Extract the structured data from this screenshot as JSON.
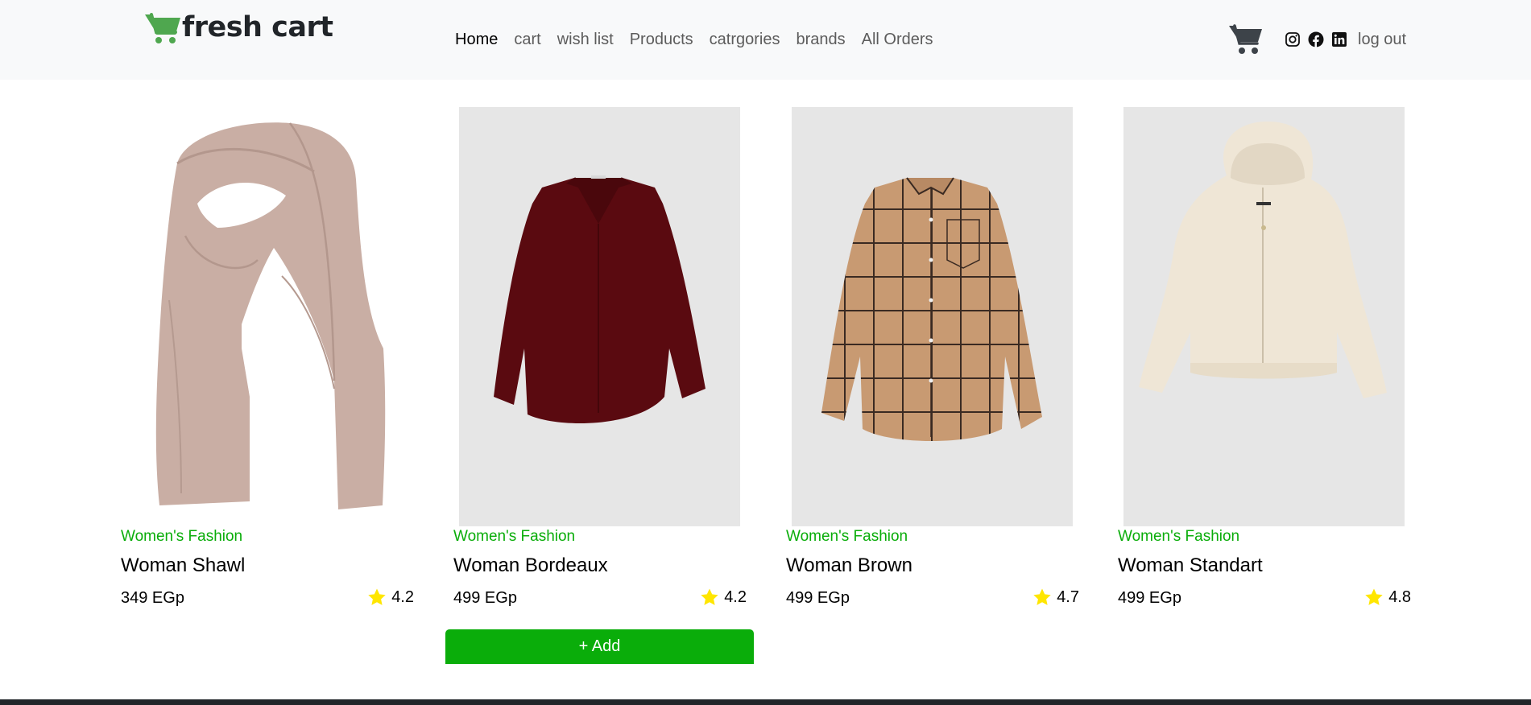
{
  "brand": {
    "name": "fresh cart",
    "icon": "cart-icon",
    "color": "#4fa74f"
  },
  "nav": {
    "links": [
      {
        "label": "Home",
        "active": true
      },
      {
        "label": "cart",
        "active": false
      },
      {
        "label": "wish list",
        "active": false
      },
      {
        "label": "Products",
        "active": false
      },
      {
        "label": "catrgories",
        "active": false
      },
      {
        "label": "brands",
        "active": false
      },
      {
        "label": "All Orders",
        "active": false
      }
    ],
    "right": {
      "cart_icon": "shopping-cart-icon",
      "social_icons": [
        "instagram-icon",
        "facebook-icon",
        "linkedin-icon"
      ],
      "logout_label": "log out"
    }
  },
  "products": [
    {
      "category": "Women's Fashion",
      "title": "Woman Shawl",
      "price": "349 EGp",
      "rating": "4.2"
    },
    {
      "category": "Women's Fashion",
      "title": "Woman Bordeaux",
      "price": "499 EGp",
      "rating": "4.2"
    },
    {
      "category": "Women's Fashion",
      "title": "Woman Brown",
      "price": "499 EGp",
      "rating": "4.7"
    },
    {
      "category": "Women's Fashion",
      "title": "Woman Standart",
      "price": "499 EGp",
      "rating": "4.8"
    }
  ],
  "add_button": {
    "label": "+ Add"
  },
  "colors": {
    "accent": "#0aad0a",
    "star": "#ffe600",
    "navbar_bg": "#f8f9fa",
    "footer": "#212529"
  }
}
